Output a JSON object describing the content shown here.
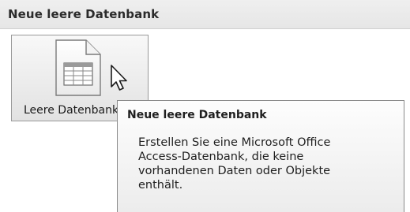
{
  "section": {
    "title": "Neue leere Datenbank"
  },
  "tile": {
    "label": "Leere Datenbank",
    "icon": "blank-database-document-icon"
  },
  "tooltip": {
    "title": "Neue leere Datenbank",
    "lines": [
      "Erstellen Sie eine Microsoft Office",
      "Access-Datenbank, die keine",
      "vorhandenen Daten oder Objekte",
      "enthält."
    ]
  },
  "cursor": {
    "icon": "mouse-pointer-icon"
  }
}
